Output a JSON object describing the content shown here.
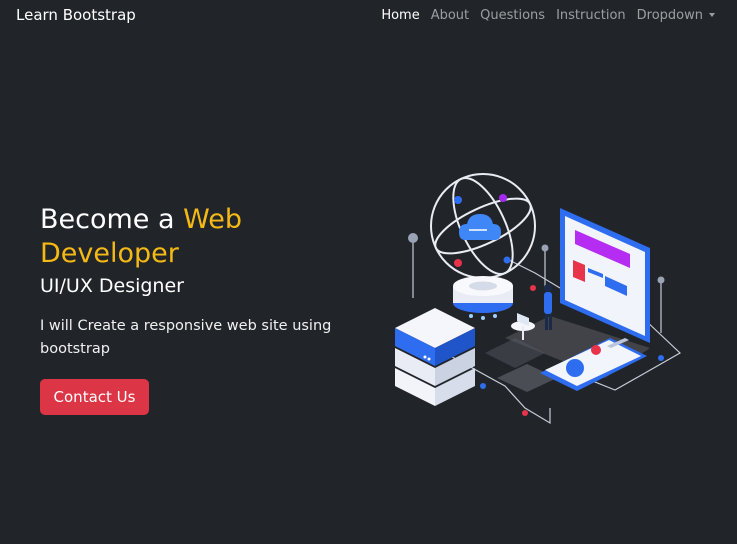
{
  "navbar": {
    "brand": "Learn Bootstrap",
    "links": [
      {
        "label": "Home",
        "active": true
      },
      {
        "label": "About",
        "active": false
      },
      {
        "label": "Questions",
        "active": false
      },
      {
        "label": "Instruction",
        "active": false
      },
      {
        "label": "Dropdown",
        "active": false
      }
    ]
  },
  "hero": {
    "headline_prefix": "Become a ",
    "headline_highlight_1": "Web",
    "headline_highlight_2": "Developer",
    "subheadline": "UI/UX Designer",
    "description": "I will Create a responsive web site using bootstrap",
    "cta_label": "Contact Us",
    "illustration_icon": "isometric-cloud-devices-illustration"
  },
  "colors": {
    "background": "#212529",
    "highlight": "#f5b916",
    "cta": "#dc3545",
    "nav_inactive": "rgba(255,255,255,0.55)"
  }
}
